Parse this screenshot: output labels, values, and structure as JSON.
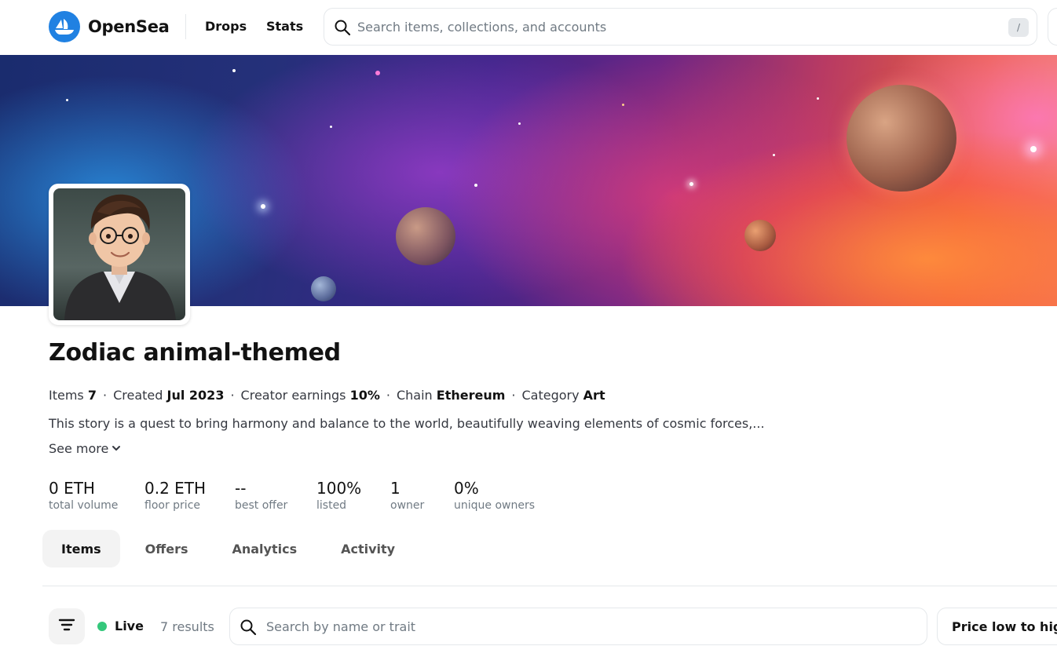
{
  "header": {
    "brand": "OpenSea",
    "nav": [
      {
        "label": "Drops"
      },
      {
        "label": "Stats"
      }
    ],
    "search_placeholder": "Search items, collections, and accounts",
    "search_shortcut": "/"
  },
  "collection": {
    "title": "Zodiac animal-themed",
    "meta": {
      "items_label": "Items",
      "items_value": "7",
      "created_label": "Created",
      "created_value": "Jul 2023",
      "earnings_label": "Creator earnings",
      "earnings_value": "10%",
      "chain_label": "Chain",
      "chain_value": "Ethereum",
      "category_label": "Category",
      "category_value": "Art",
      "separator": "·"
    },
    "description": "This story is a quest to bring harmony and balance to the world, beautifully weaving elements of cosmic forces,...",
    "see_more": "See more"
  },
  "stats": [
    {
      "value": "0 ETH",
      "label": "total volume"
    },
    {
      "value": "0.2 ETH",
      "label": "floor price"
    },
    {
      "value": "--",
      "label": "best offer"
    },
    {
      "value": "100%",
      "label": "listed"
    },
    {
      "value": "1",
      "label": "owner"
    },
    {
      "value": "0%",
      "label": "unique owners"
    }
  ],
  "tabs": [
    {
      "label": "Items",
      "active": true
    },
    {
      "label": "Offers"
    },
    {
      "label": "Analytics"
    },
    {
      "label": "Activity"
    }
  ],
  "toolbar": {
    "live_label": "Live",
    "results": "7 results",
    "search_placeholder": "Search by name or trait",
    "sort_label": "Price low to high"
  },
  "colors": {
    "brand_blue": "#2081e2",
    "live_green": "#34c77b",
    "text_primary": "#121212",
    "text_secondary": "#707a83"
  }
}
